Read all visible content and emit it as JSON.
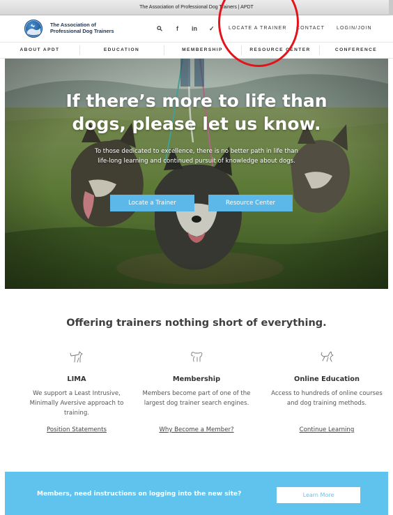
{
  "window": {
    "title": "The Association of Professional Dog Trainers | APDT"
  },
  "header": {
    "brand_line1": "The Association of",
    "brand_line2": "Professional Dog Trainers",
    "icons": [
      "search-icon",
      "facebook-icon",
      "linkedin-icon",
      "twitter-icon"
    ],
    "icon_glyphs": {
      "search": "⚲",
      "facebook": "f",
      "linkedin": "in",
      "twitter": "✓"
    },
    "links": {
      "locate": "LOCATE A TRAINER",
      "contact": "CONTACT",
      "login": "LOGIN/JOIN"
    }
  },
  "nav": {
    "items": [
      "ABOUT APDT",
      "EDUCATION",
      "MEMBERSHIP",
      "RESOURCE CENTER",
      "CONFERENCE"
    ]
  },
  "hero": {
    "title_line1": "If there’s more to life than",
    "title_line2": "dogs, please let us know.",
    "subtitle": "To those dedicated to excellence, there is no better path in life than life-long learning and continued pursuit of knowledge about dogs.",
    "buttons": [
      "Locate a Trainer",
      "Resource Center"
    ]
  },
  "offering": {
    "title": "Offering trainers nothing short of everything.",
    "columns": [
      {
        "heading": "LIMA",
        "text": "We support a Least Intrusive, Minimally Aversive approach to training.",
        "link": "Position Statements",
        "icon": "dog-icon"
      },
      {
        "heading": "Membership",
        "text": "Members become part of one of the largest dog trainer search engines.",
        "link": "Why Become a Member?",
        "icon": "dog-icon"
      },
      {
        "heading": "Online Education",
        "text": "Access to hundreds of online courses and dog training methods.",
        "link": "Continue Learning",
        "icon": "dog-icon"
      }
    ]
  },
  "banner": {
    "message": "Members, need instructions on logging into the new site?",
    "button": "Learn More"
  },
  "colors": {
    "accent": "#5bb8e8",
    "banner": "#5fc3ee",
    "annotation_circle": "#e2141a",
    "brand_text": "#1e3350"
  }
}
